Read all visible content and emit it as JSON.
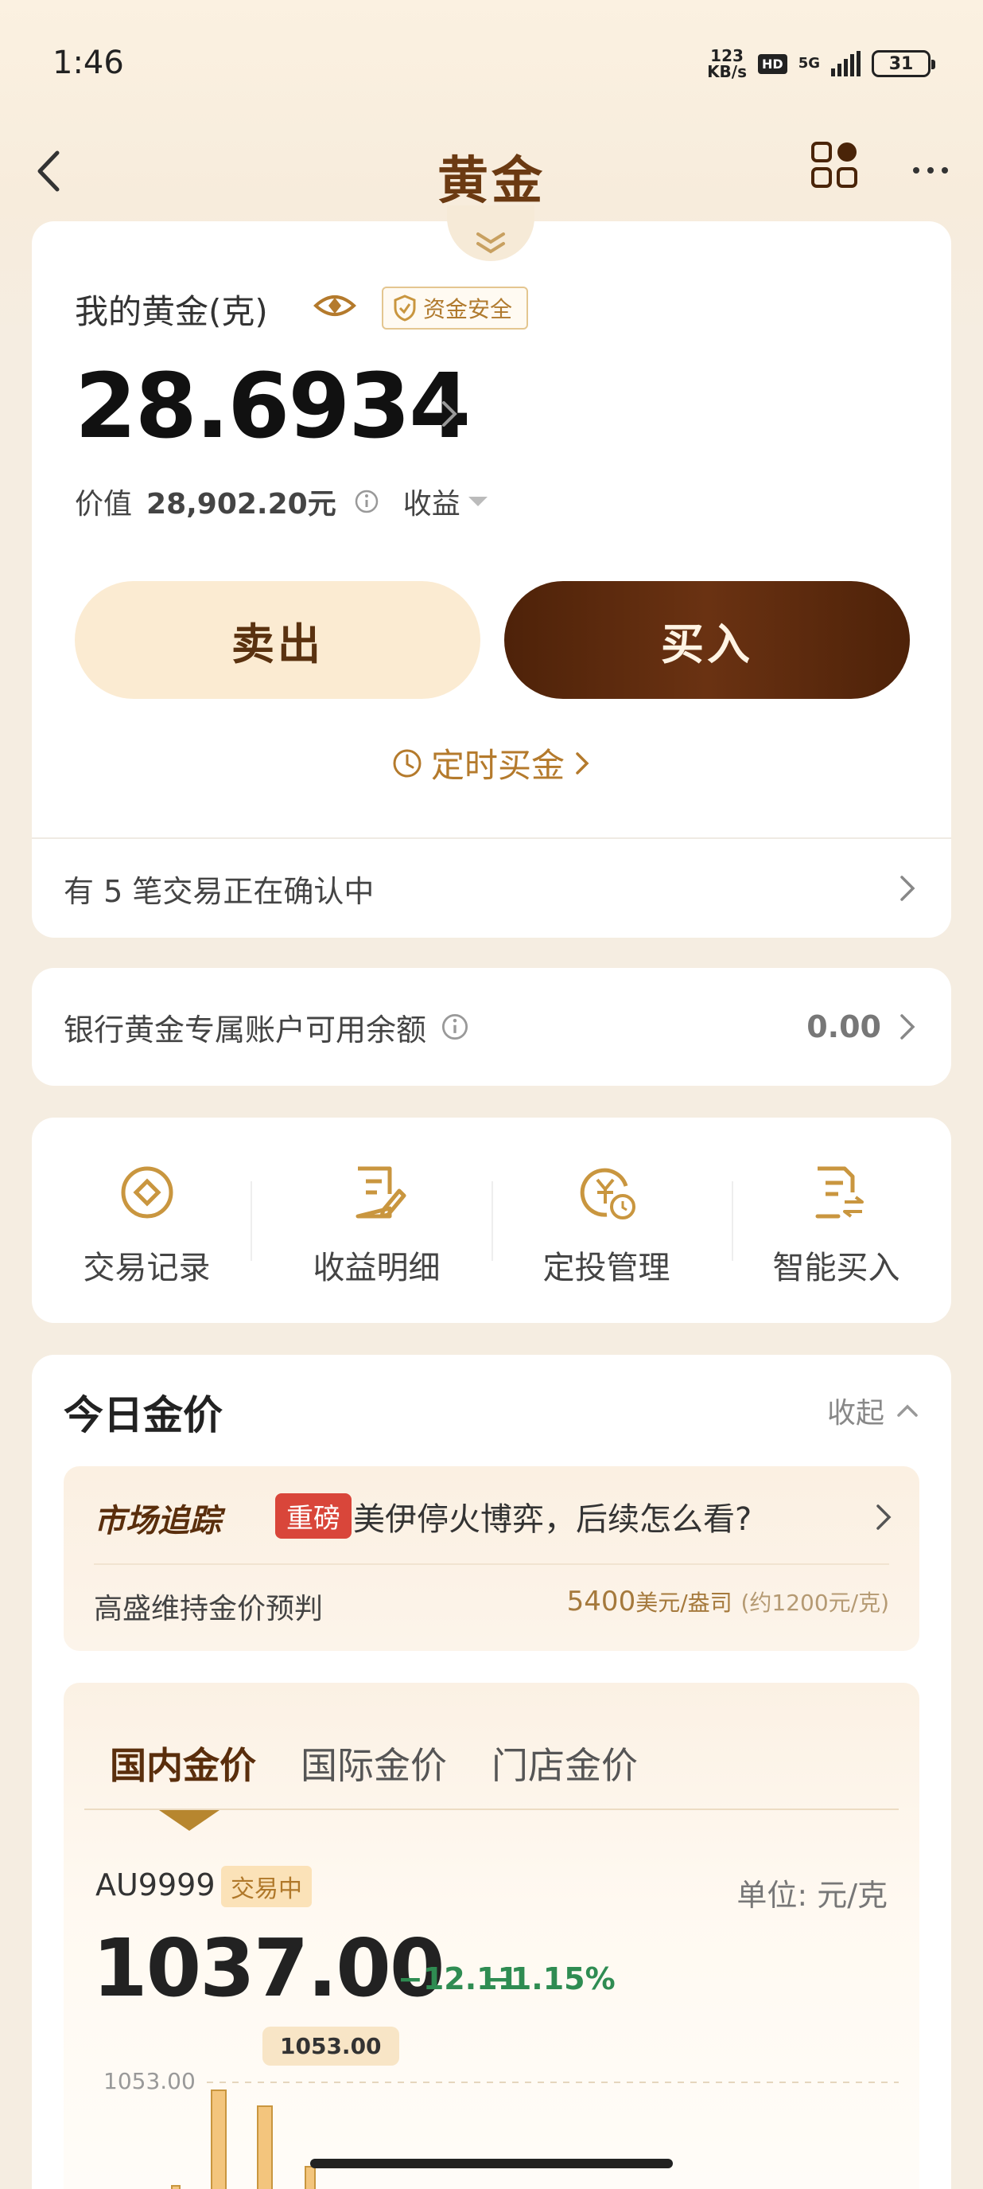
{
  "status_bar": {
    "time": "1:46",
    "net_speed_value": "123",
    "net_speed_unit": "KB/s",
    "hd": "HD",
    "network": "5G",
    "battery": "31"
  },
  "header": {
    "title": "黄金"
  },
  "gold": {
    "label": "我的黄金(克)",
    "safe_badge": "资金安全",
    "amount": "28.6934",
    "value_label": "价值",
    "value": "28,902.20元",
    "profit_label": "收益",
    "sell_label": "卖出",
    "buy_label": "买入",
    "timed_buy_label": "定时买金",
    "pending_text": "有 5 笔交易正在确认中"
  },
  "balance": {
    "label": "银行黄金专属账户可用余额",
    "value": "0.00"
  },
  "menu": {
    "items": [
      {
        "label": "交易记录",
        "icon": "target-icon"
      },
      {
        "label": "收益明细",
        "icon": "document-edit-icon"
      },
      {
        "label": "定投管理",
        "icon": "yuan-clock-icon"
      },
      {
        "label": "智能买入",
        "icon": "document-exchange-icon"
      }
    ]
  },
  "price": {
    "title": "今日金价",
    "collapse_label": "收起",
    "news": {
      "tag": "市场追踪",
      "badge": "重磅",
      "headline": "美伊停火博弈，后续怎么看?",
      "sub": "高盛维持金价预判",
      "forecast_value": "5400",
      "forecast_unit": "美元/盎司",
      "forecast_approx": "(约1200元/克)"
    },
    "tabs": [
      "国内金价",
      "国际金价",
      "门店金价"
    ],
    "code": "AU9999",
    "status": "交易中",
    "unit": "单位: 元/克",
    "current": "1037.00",
    "change": "−12.11",
    "change_pct": "−1.15%",
    "tooltip": "1053.00",
    "axis_label": "1053.00"
  },
  "colors": {
    "brand_brown": "#5a2e0c",
    "gold_accent": "#b47a2c",
    "down_green": "#2f8c52",
    "news_red": "#d9463a"
  }
}
